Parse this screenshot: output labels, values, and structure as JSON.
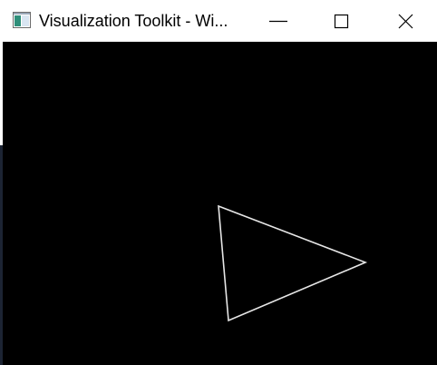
{
  "window": {
    "title": "Visualization Toolkit - Wi...",
    "app_icon": "vtk-app-icon",
    "controls": {
      "minimize_icon": "minimize-icon",
      "maximize_icon": "maximize-icon",
      "close_icon": "close-icon"
    }
  },
  "render_view": {
    "background_color": "#000000",
    "shape": "triangle-outline",
    "line_color": "#e6e6e6"
  }
}
